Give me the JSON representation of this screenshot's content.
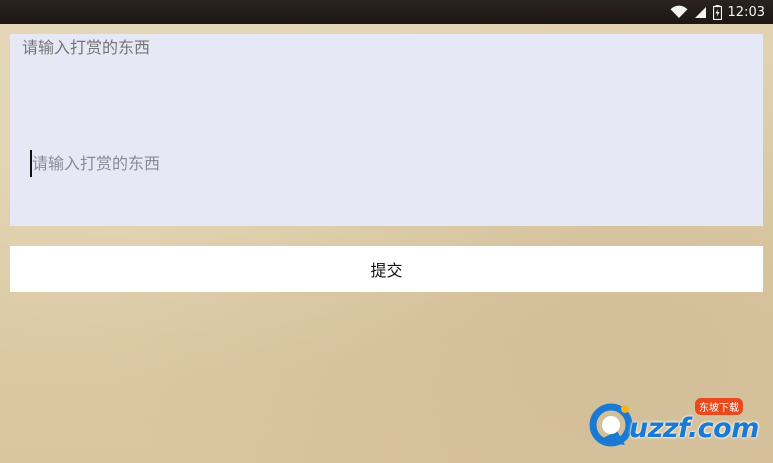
{
  "status_bar": {
    "time": "12:03",
    "icons": [
      "wifi-icon",
      "signal-icon",
      "battery-charging-icon"
    ]
  },
  "form": {
    "input_placeholder": "请输入打赏的东西",
    "input_value": "",
    "submit_label": "提交"
  },
  "watermark": {
    "text": "uzzf.com",
    "sub_text": "东坡下载"
  },
  "colors": {
    "status_bar_bg": "#1c1714",
    "input_bg": "#e7e8f6",
    "button_bg": "#ffffff",
    "page_bg": "#ddcba5",
    "watermark_blue": "#1a7ad3",
    "watermark_orange": "#e8491d"
  }
}
